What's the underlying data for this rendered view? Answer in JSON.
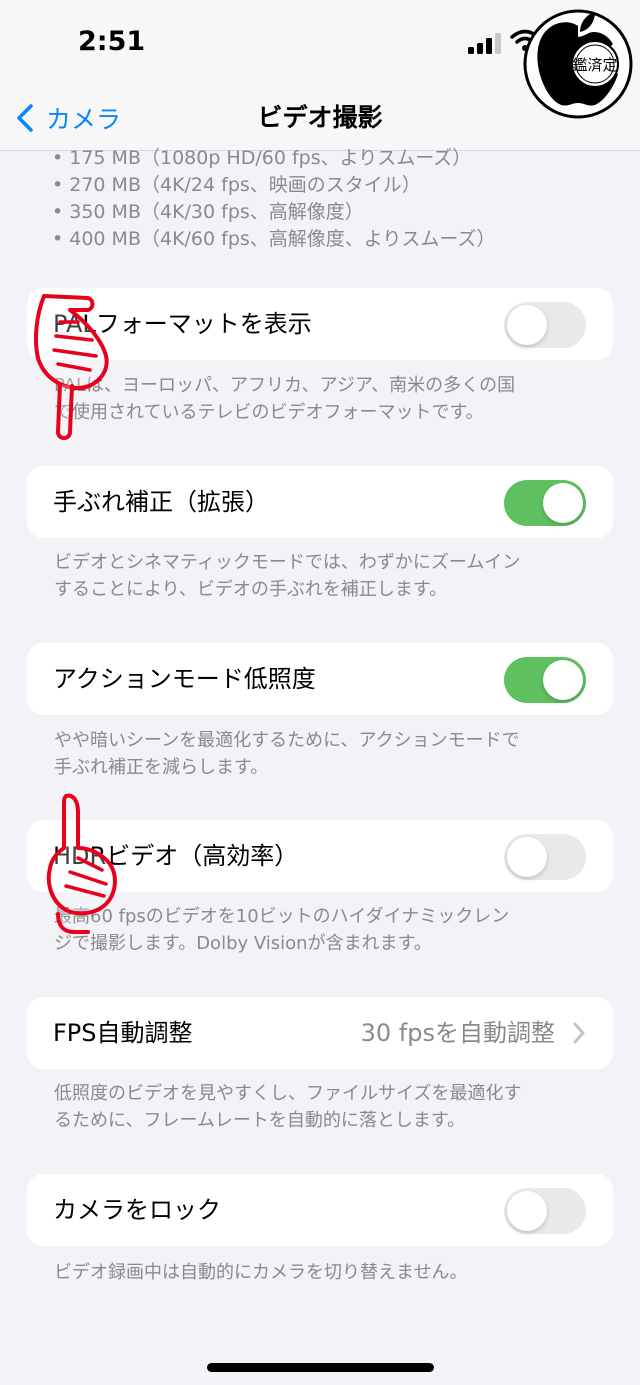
{
  "status_bar": {
    "time": "2:51"
  },
  "nav": {
    "back_label": "カメラ",
    "title": "ビデオ撮影"
  },
  "badge": {
    "text": "鑑済定"
  },
  "sizes": [
    "• 175 MB（1080p HD/60 fps、よりスムーズ）",
    "• 270 MB（4K/24 fps、映画のスタイル）",
    "• 350 MB（4K/30 fps、高解像度）",
    "• 400 MB（4K/60 fps、高解像度、よりスムーズ）"
  ],
  "settings": [
    {
      "label": "PALフォーマットを表示",
      "on": false,
      "footer": [
        "PALは、ヨーロッパ、アフリカ、アジア、南米の多くの国",
        "で使用されているテレビのビデオフォーマットです。"
      ]
    },
    {
      "label": "手ぶれ補正（拡張）",
      "on": true,
      "footer": [
        "ビデオとシネマティックモードでは、わずかにズームイン",
        "することにより、ビデオの手ぶれを補正します。"
      ]
    },
    {
      "label": "アクションモード低照度",
      "on": true,
      "footer": [
        "やや暗いシーンを最適化するために、アクションモードで",
        "手ぶれ補正を減らします。"
      ]
    },
    {
      "label": "HDRビデオ（高効率）",
      "on": false,
      "footer": [
        "最高60 fpsのビデオを10ビットのハイダイナミックレン",
        "ジで撮影します。Dolby Visionが含まれます。"
      ]
    },
    {
      "label": "FPS自動調整",
      "value": "30 fpsを自動調整",
      "footer": [
        "低照度のビデオを見やすくし、ファイルサイズを最適化す",
        "るために、フレームレートを自動的に落とします。"
      ]
    },
    {
      "label": "カメラをロック",
      "on": false,
      "footer": [
        "ビデオ録画中は自動的にカメラを切り替えません。"
      ]
    }
  ],
  "colors": {
    "accent": "#0a84ff",
    "toggle_on": "#5ec05e",
    "toggle_off": "#e9e9eb",
    "annotation": "#e8001c"
  },
  "icons": [
    "chevron-left-icon",
    "cellular-signal-icon",
    "wifi-icon",
    "apple-logo-icon",
    "pointing-hand-icon",
    "chevron-right-icon"
  ]
}
